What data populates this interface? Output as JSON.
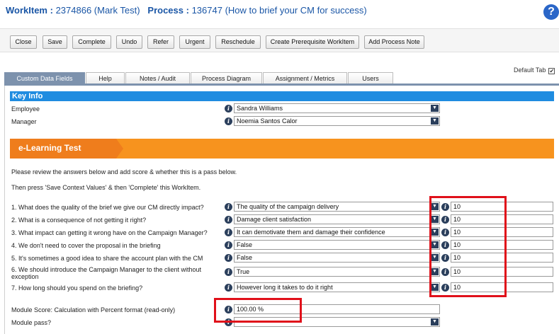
{
  "header": {
    "workitem_label": "WorkItem :",
    "workitem_value": "2374866 (Mark Test)",
    "process_label": "Process :",
    "process_value": "136747 (How to brief your CM for success)"
  },
  "toolbar": {
    "buttons": [
      "Close",
      "Save",
      "Complete",
      "Undo",
      "Refer",
      "Urgent",
      "Reschedule",
      "Create Prerequisite WorkItem",
      "Add Process Note"
    ]
  },
  "default_tab": {
    "label": "Default Tab",
    "checked": "✔"
  },
  "tabs": [
    "Custom Data Fields",
    "Help",
    "Notes / Audit",
    "Process Diagram",
    "Assignment / Metrics",
    "Users"
  ],
  "key_info": {
    "title": "Key Info",
    "employee_label": "Employee",
    "employee_value": "Sandra Williams",
    "manager_label": "Manager",
    "manager_value": "Noemia Santos Calor"
  },
  "section": {
    "title": "e-Learning Test",
    "instruction_1": "Please review the answers below and add score & whether this is a pass below.",
    "instruction_2": "Then press 'Save Context Values' & then 'Complete' this WorkItem."
  },
  "questions": [
    {
      "label": "1. What does the quality of the brief we give our CM directly impact?",
      "answer": "The quality of the campaign delivery",
      "score": "10"
    },
    {
      "label": "2. What is a consequence of not getting it right?",
      "answer": "Damage client satisfaction",
      "score": "10"
    },
    {
      "label": "3. What impact can getting it wrong have on the Campaign Manager?",
      "answer": "It can demotivate them and damage their confidence",
      "score": "10"
    },
    {
      "label": "4. We don't need to cover the proposal in the briefing",
      "answer": "False",
      "score": "10"
    },
    {
      "label": "5. It's sometimes a good idea to share the account plan with the CM",
      "answer": "False",
      "score": "10"
    },
    {
      "label_1": "6. We should introduce the Campaign Manager to the client without",
      "label_2": "exception",
      "answer": "True",
      "score": "10"
    },
    {
      "label": "7. How long should you spend on the briefing?",
      "answer": "However long it takes to do it right",
      "score": "10"
    }
  ],
  "module": {
    "score_label": "Module Score: Calculation with Percent format (read-only)",
    "score_value": "100.00 %",
    "pass_label": "Module pass?",
    "pass_value": ""
  },
  "colors": {
    "title_blue": "#1a56a6",
    "key_info_bar": "#1f8ce0",
    "banner_orange": "#f7931e",
    "active_tab": "#7d92ad",
    "highlight_red": "#e0101a"
  }
}
